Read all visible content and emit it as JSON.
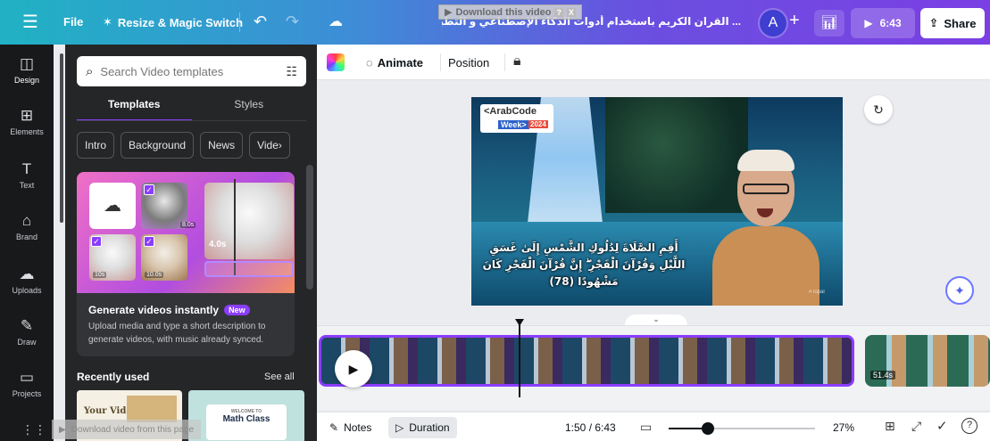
{
  "topbar": {
    "menu_icon": "hamburger-icon",
    "file_label": "File",
    "resize_label": "Resize & Magic Switch",
    "doc_title": "... القران الكريم باستخدام أدوات الذكاء الإصطناعي و التطبيقات الذكية -",
    "download_banner": "Download this video",
    "download_banner_extra": "?",
    "download_banner_close": "X",
    "avatar_letter": "A",
    "present_time": "6:43",
    "share_label": "Share",
    "gradient_colors": [
      "#20b2c4",
      "#6a4fe0",
      "#7b3fe4"
    ]
  },
  "rail": {
    "items": [
      {
        "label": "Design",
        "icon": "layout-icon"
      },
      {
        "label": "Elements",
        "icon": "elements-icon"
      },
      {
        "label": "Text",
        "icon": "text-icon"
      },
      {
        "label": "Brand",
        "icon": "brand-icon"
      },
      {
        "label": "Uploads",
        "icon": "upload-cloud-icon"
      },
      {
        "label": "Draw",
        "icon": "draw-icon"
      },
      {
        "label": "Projects",
        "icon": "folder-icon"
      }
    ]
  },
  "panel": {
    "search_placeholder": "Search Video templates",
    "tabs": [
      {
        "label": "Templates",
        "active": true
      },
      {
        "label": "Styles",
        "active": false
      }
    ],
    "chips": [
      "Intro",
      "Background",
      "News",
      "Vide›"
    ],
    "promo": {
      "title": "Generate videos instantly",
      "badge": "New",
      "description": "Upload media and type a short description to generate videos, with music already synced.",
      "art_time": "4.0s",
      "clip_times": [
        "10s",
        "10.0s",
        "8.0s"
      ]
    },
    "recent_title": "Recently used",
    "see_all": "See all",
    "recent": [
      {
        "title": "Your Video Lesson"
      },
      {
        "title": "Math Class",
        "subtitle": "WELCOME TO"
      }
    ]
  },
  "toolbar": {
    "animate_label": "Animate",
    "position_label": "Position"
  },
  "slide": {
    "logo_line1": "<ArabCode",
    "logo_line2": "Week>",
    "logo_year": "2024",
    "ayah_text": "أَقِمِ الصَّلَاةَ لِدُلُوكِ الشَّمْسِ إِلَىٰ غَسَقِ اللَّيْلِ وَقُرْآنَ الْفَجْرِ ۖ إِنَّ قُرْآنَ الْفَجْرِ كَانَ مَشْهُودًا (78)",
    "watermark": "#Topal"
  },
  "timeline": {
    "clip2_label": "51.4s"
  },
  "bottombar": {
    "notes_label": "Notes",
    "duration_label": "Duration",
    "time_display": "1:50 / 6:43",
    "zoom_label": "27%",
    "zoom_fraction": 0.27
  },
  "overlay": {
    "download_bottom": "Download video from this page"
  }
}
